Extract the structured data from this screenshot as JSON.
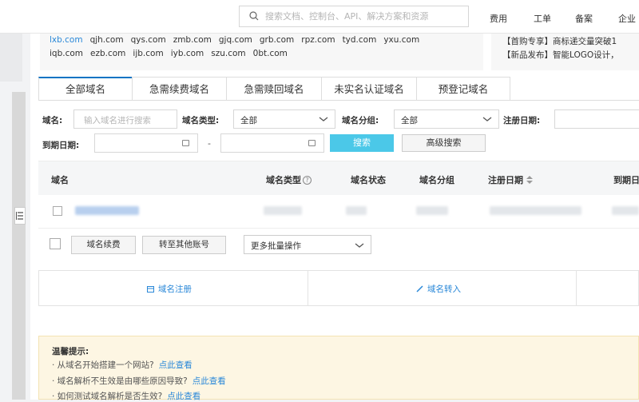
{
  "header": {
    "search_placeholder": "搜索文档、控制台、API、解决方案和资源",
    "nav": [
      "费用",
      "工单",
      "备案",
      "企业"
    ]
  },
  "suffixes": {
    "row1": [
      "lxb.com",
      "qjh.com",
      "qys.com",
      "zmb.com",
      "gjq.com",
      "grb.com",
      "rpz.com",
      "tyd.com",
      "yxu.com"
    ],
    "row2": [
      "iqb.com",
      "ezb.com",
      "ijb.com",
      "iyb.com",
      "szu.com",
      "0bt.com"
    ]
  },
  "news": {
    "line1": "【首购专享】商标递交量突破1",
    "line2": "【新品发布】智能LOGO设计，"
  },
  "tabs": [
    "全部域名",
    "急需续费域名",
    "急需赎回域名",
    "未实名认证域名",
    "预登记域名"
  ],
  "filters": {
    "domain_label": "域名:",
    "domain_placeholder": "输入域名进行搜索",
    "type_label": "域名类型:",
    "type_value": "全部",
    "group_label": "域名分组:",
    "group_value": "全部",
    "reg_date_label": "注册日期:",
    "expire_date_label": "到期日期:",
    "range_sep": "-",
    "search_button": "搜索",
    "advanced_button": "高级搜索"
  },
  "table": {
    "headers": [
      "域名",
      "域名类型",
      "域名状态",
      "域名分组",
      "注册日期",
      "到期日"
    ],
    "help_glyph": "?"
  },
  "batch": {
    "renew_button": "域名续费",
    "transfer_button": "转至其他账号",
    "more_label": "更多批量操作"
  },
  "quick": {
    "register_label": "域名注册",
    "transfer_in_label": "域名转入"
  },
  "tips": {
    "title": "温馨提示:",
    "items": [
      {
        "text": "· 从域名开始搭建一个网站?",
        "link": "点此查看"
      },
      {
        "text": "· 域名解析不生效是由哪些原因导致?",
        "link": "点此查看"
      },
      {
        "text": "· 如何测试域名解析是否生效?",
        "link": "点此查看"
      }
    ]
  },
  "colors": {
    "accent": "#0b74c4",
    "link": "#2a88d8",
    "search_button": "#4bc8e8",
    "tips_bg": "#fdf6e3"
  }
}
